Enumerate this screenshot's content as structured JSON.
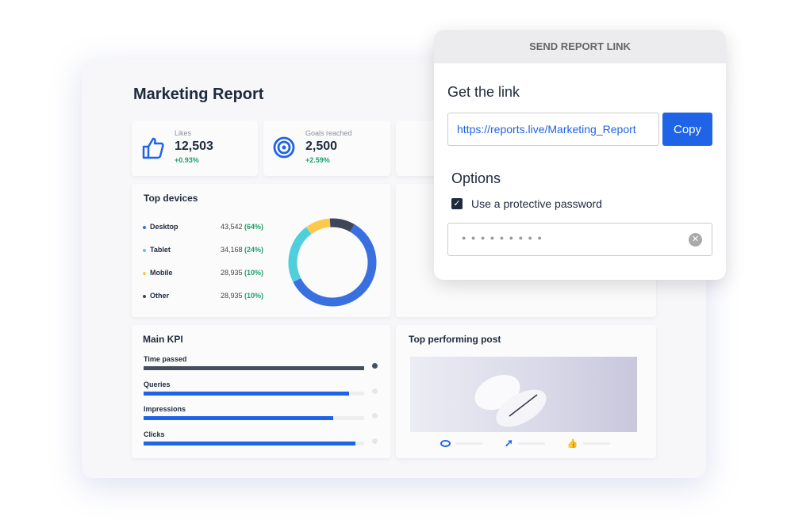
{
  "report": {
    "title": "Marketing Report"
  },
  "stats": [
    {
      "label": "Likes",
      "value": "12,503",
      "change": "+0.93%",
      "icon": "thumbs-up-icon"
    },
    {
      "label": "Goals reached",
      "value": "2,500",
      "change": "+2.59%",
      "icon": "target-icon"
    }
  ],
  "devices": {
    "title": "Top devices",
    "items": [
      {
        "name": "Desktop",
        "count": "43,542",
        "pct": "(64%)",
        "color": "#3a6fe0"
      },
      {
        "name": "Tablet",
        "count": "34,168",
        "pct": "(24%)",
        "color": "#4fcfdc"
      },
      {
        "name": "Mobile",
        "count": "28,935",
        "pct": "(10%)",
        "color": "#fcc94c"
      },
      {
        "name": "Other",
        "count": "28,935",
        "pct": "(10%)",
        "color": "#3d4757"
      }
    ]
  },
  "kpi": {
    "title": "Main KPI",
    "items": [
      {
        "label": "Time passed",
        "progress": 1.0,
        "color": "#454f5e",
        "done": true
      },
      {
        "label": "Queries",
        "progress": 0.93,
        "color": "#1f63e6",
        "done": false
      },
      {
        "label": "Impressions",
        "progress": 0.86,
        "color": "#1f63e6",
        "done": false
      },
      {
        "label": "Clicks",
        "progress": 0.96,
        "color": "#1f63e6",
        "done": false
      }
    ]
  },
  "post": {
    "title": "Top performing post"
  },
  "popup": {
    "header": "SEND REPORT LINK",
    "get_link": "Get the link",
    "url": "https://reports.live/Marketing_Report",
    "copy": "Copy",
    "options": "Options",
    "password_label": "Use a protective password",
    "password_checked": true,
    "password_mask": "● ● ● ● ● ● ● ● ●"
  }
}
